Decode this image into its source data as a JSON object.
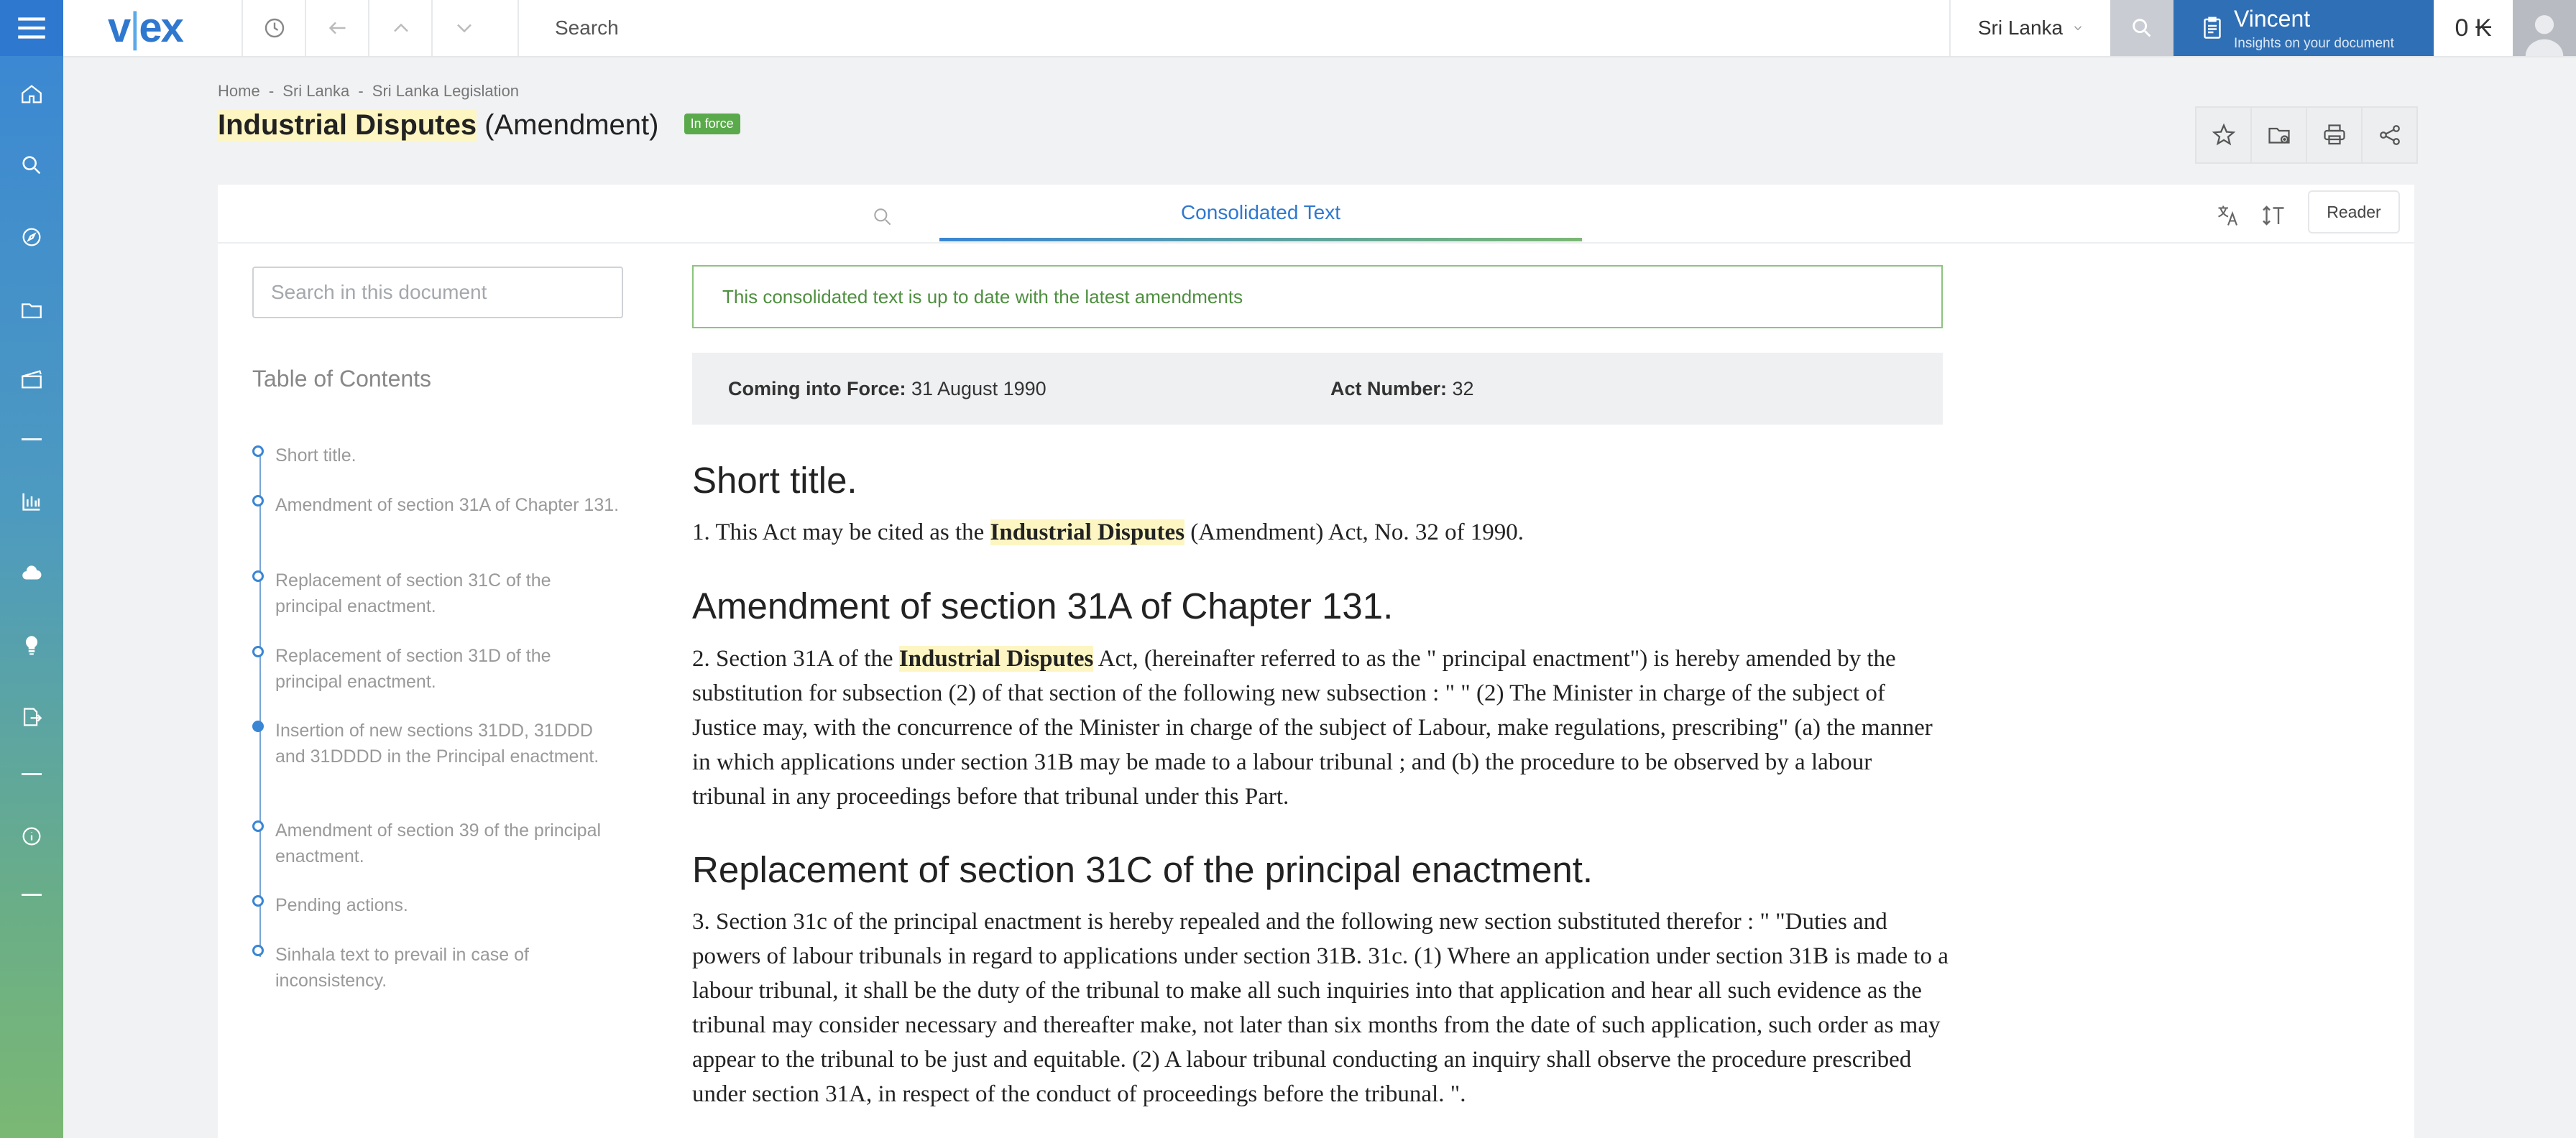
{
  "app": {
    "brand": "vlex",
    "brand_v": "v",
    "brand_bar": "|",
    "brand_rest": "ex"
  },
  "topbar": {
    "search_placeholder": "Search",
    "country": "Sri Lanka",
    "assistant_name": "Vincent",
    "assistant_subtitle": "Insights on your document",
    "credits": "0 ₭"
  },
  "breadcrumb": [
    "Home",
    "-",
    "Sri Lanka",
    "-",
    "Sri Lanka Legislation"
  ],
  "document": {
    "title_highlight": "Industrial Disputes",
    "title_rest": " (Amendment)",
    "status_badge": "In force"
  },
  "tabs": {
    "active": "Consolidated Text",
    "reader": "Reader"
  },
  "doc_search": {
    "placeholder": "Search in this document"
  },
  "toc": {
    "heading": "Table of Contents",
    "items": [
      "Short title.",
      "Amendment of section 31A of Chapter 131.",
      "Replacement of section 31C of the principal enactment.",
      "Replacement of section 31D of the principal enactment.",
      "Insertion of new sections 31DD, 31DDD and 31DDDD in the Principal enactment.",
      "Amendment of section 39 of the principal enactment.",
      "Pending actions.",
      "Sinhala text to prevail in case of inconsistency."
    ],
    "active_index": 4
  },
  "notice": "This consolidated text is up to date with the latest amendments",
  "meta": {
    "force_label": "Coming into Force:",
    "force_value": " 31 August 1990",
    "act_label": "Act Number:",
    "act_value": " 32"
  },
  "sections": [
    {
      "title": "Short title.",
      "pre": "1. This Act may be cited as the ",
      "highlight": "Industrial Disputes",
      "post": " (Amendment) Act, No. 32 of 1990."
    },
    {
      "title": "Amendment of section 31A of Chapter 131.",
      "pre": "2. Section 31A of the ",
      "highlight": "Industrial Disputes",
      "post": " Act, (hereinafter referred to as the \" principal enactment\") is hereby amended by the substitution for subsection (2) of that section of the following new subsection : \" \" (2) The Minister in charge of the subject of Justice may, with the concurrence of the Minister in charge of the subject of Labour, make regulations, prescribing\" (a) the manner in which applications under section 31B may be made to a labour tribunal ; and (b) the procedure to be observed by a labour tribunal in any proceedings before that tribunal under this Part."
    },
    {
      "title": "Replacement of section 31C of the principal enactment.",
      "pre": "3. Section 31c of the principal enactment is hereby repealed and the following new section substituted therefor : \" \"Duties and powers of labour tribunals in regard to applications under section 31B. 31c. (1) Where an application under section 31B is made to a labour tribunal, it shall be the duty of the tribunal to make all such inquiries into that application and hear all such evidence as the tribunal may consider necessary and thereafter make, not later than six months from the date of such application, such order as may appear to the tribunal to be just and equitable. (2) A labour tribunal conducting an inquiry shall observe the procedure prescribed under section 31A, in respect of the conduct of proceedings before the tribunal. \".",
      "highlight": "",
      "post": ""
    }
  ],
  "colors": {
    "brand": "#2f78cf",
    "highlight": "#fdf6c3",
    "status_green": "#5aaa4b",
    "notice_green": "#4e8f3f"
  }
}
